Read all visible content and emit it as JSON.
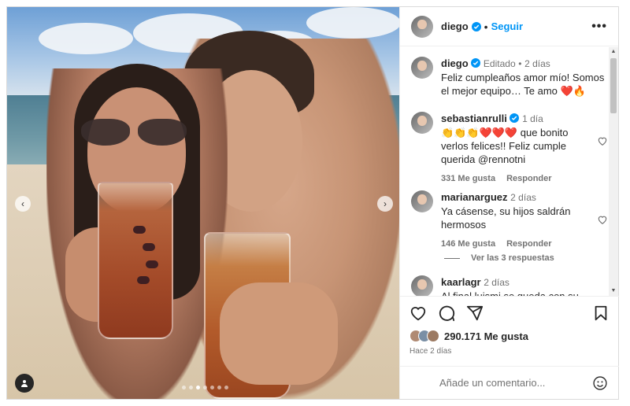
{
  "post": {
    "username": "diego",
    "follow_label": "Seguir",
    "more_label": "•••",
    "carousel": {
      "total": 7,
      "current": 3
    }
  },
  "caption": {
    "username": "diego",
    "edited": "Editado",
    "time": "2 días",
    "text": "Feliz cumpleaños amor mío! Somos el mejor equipo… Te amo ❤️🔥"
  },
  "comments": [
    {
      "username": "sebastianrulli",
      "verified": true,
      "time": "1 día",
      "text": "👏👏👏❤️❤️❤️ que bonito verlos felices!! Feliz cumple querida @rennotni",
      "likes": "331 Me gusta",
      "reply": "Responder"
    },
    {
      "username": "marianarguez",
      "verified": false,
      "time": "2 días",
      "text": "Ya cásense, su hijos saldrán hermosos",
      "likes": "146 Me gusta",
      "reply": "Responder",
      "view_replies": "Ver las 3 respuestas"
    },
    {
      "username": "kaarlagr",
      "verified": false,
      "time": "2 días",
      "text": "Al final luismi se queda con su"
    }
  ],
  "stats": {
    "likes": "290.171 Me gusta",
    "posted": "Hace 2 días"
  },
  "composer": {
    "placeholder": "Añade un comentario..."
  },
  "colors": {
    "link": "#0095f6",
    "verified": "#0095f6",
    "muted": "#737373"
  }
}
